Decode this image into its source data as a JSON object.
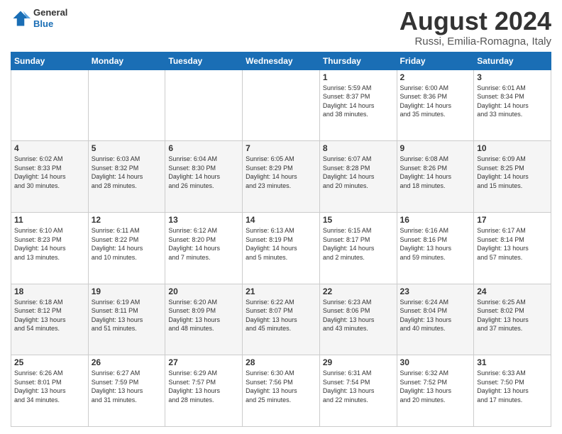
{
  "logo": {
    "line1": "General",
    "line2": "Blue"
  },
  "title": "August 2024",
  "subtitle": "Russi, Emilia-Romagna, Italy",
  "weekdays": [
    "Sunday",
    "Monday",
    "Tuesday",
    "Wednesday",
    "Thursday",
    "Friday",
    "Saturday"
  ],
  "weeks": [
    [
      {
        "day": "",
        "info": ""
      },
      {
        "day": "",
        "info": ""
      },
      {
        "day": "",
        "info": ""
      },
      {
        "day": "",
        "info": ""
      },
      {
        "day": "1",
        "info": "Sunrise: 5:59 AM\nSunset: 8:37 PM\nDaylight: 14 hours\nand 38 minutes."
      },
      {
        "day": "2",
        "info": "Sunrise: 6:00 AM\nSunset: 8:36 PM\nDaylight: 14 hours\nand 35 minutes."
      },
      {
        "day": "3",
        "info": "Sunrise: 6:01 AM\nSunset: 8:34 PM\nDaylight: 14 hours\nand 33 minutes."
      }
    ],
    [
      {
        "day": "4",
        "info": "Sunrise: 6:02 AM\nSunset: 8:33 PM\nDaylight: 14 hours\nand 30 minutes."
      },
      {
        "day": "5",
        "info": "Sunrise: 6:03 AM\nSunset: 8:32 PM\nDaylight: 14 hours\nand 28 minutes."
      },
      {
        "day": "6",
        "info": "Sunrise: 6:04 AM\nSunset: 8:30 PM\nDaylight: 14 hours\nand 26 minutes."
      },
      {
        "day": "7",
        "info": "Sunrise: 6:05 AM\nSunset: 8:29 PM\nDaylight: 14 hours\nand 23 minutes."
      },
      {
        "day": "8",
        "info": "Sunrise: 6:07 AM\nSunset: 8:28 PM\nDaylight: 14 hours\nand 20 minutes."
      },
      {
        "day": "9",
        "info": "Sunrise: 6:08 AM\nSunset: 8:26 PM\nDaylight: 14 hours\nand 18 minutes."
      },
      {
        "day": "10",
        "info": "Sunrise: 6:09 AM\nSunset: 8:25 PM\nDaylight: 14 hours\nand 15 minutes."
      }
    ],
    [
      {
        "day": "11",
        "info": "Sunrise: 6:10 AM\nSunset: 8:23 PM\nDaylight: 14 hours\nand 13 minutes."
      },
      {
        "day": "12",
        "info": "Sunrise: 6:11 AM\nSunset: 8:22 PM\nDaylight: 14 hours\nand 10 minutes."
      },
      {
        "day": "13",
        "info": "Sunrise: 6:12 AM\nSunset: 8:20 PM\nDaylight: 14 hours\nand 7 minutes."
      },
      {
        "day": "14",
        "info": "Sunrise: 6:13 AM\nSunset: 8:19 PM\nDaylight: 14 hours\nand 5 minutes."
      },
      {
        "day": "15",
        "info": "Sunrise: 6:15 AM\nSunset: 8:17 PM\nDaylight: 14 hours\nand 2 minutes."
      },
      {
        "day": "16",
        "info": "Sunrise: 6:16 AM\nSunset: 8:16 PM\nDaylight: 13 hours\nand 59 minutes."
      },
      {
        "day": "17",
        "info": "Sunrise: 6:17 AM\nSunset: 8:14 PM\nDaylight: 13 hours\nand 57 minutes."
      }
    ],
    [
      {
        "day": "18",
        "info": "Sunrise: 6:18 AM\nSunset: 8:12 PM\nDaylight: 13 hours\nand 54 minutes."
      },
      {
        "day": "19",
        "info": "Sunrise: 6:19 AM\nSunset: 8:11 PM\nDaylight: 13 hours\nand 51 minutes."
      },
      {
        "day": "20",
        "info": "Sunrise: 6:20 AM\nSunset: 8:09 PM\nDaylight: 13 hours\nand 48 minutes."
      },
      {
        "day": "21",
        "info": "Sunrise: 6:22 AM\nSunset: 8:07 PM\nDaylight: 13 hours\nand 45 minutes."
      },
      {
        "day": "22",
        "info": "Sunrise: 6:23 AM\nSunset: 8:06 PM\nDaylight: 13 hours\nand 43 minutes."
      },
      {
        "day": "23",
        "info": "Sunrise: 6:24 AM\nSunset: 8:04 PM\nDaylight: 13 hours\nand 40 minutes."
      },
      {
        "day": "24",
        "info": "Sunrise: 6:25 AM\nSunset: 8:02 PM\nDaylight: 13 hours\nand 37 minutes."
      }
    ],
    [
      {
        "day": "25",
        "info": "Sunrise: 6:26 AM\nSunset: 8:01 PM\nDaylight: 13 hours\nand 34 minutes."
      },
      {
        "day": "26",
        "info": "Sunrise: 6:27 AM\nSunset: 7:59 PM\nDaylight: 13 hours\nand 31 minutes."
      },
      {
        "day": "27",
        "info": "Sunrise: 6:29 AM\nSunset: 7:57 PM\nDaylight: 13 hours\nand 28 minutes."
      },
      {
        "day": "28",
        "info": "Sunrise: 6:30 AM\nSunset: 7:56 PM\nDaylight: 13 hours\nand 25 minutes."
      },
      {
        "day": "29",
        "info": "Sunrise: 6:31 AM\nSunset: 7:54 PM\nDaylight: 13 hours\nand 22 minutes."
      },
      {
        "day": "30",
        "info": "Sunrise: 6:32 AM\nSunset: 7:52 PM\nDaylight: 13 hours\nand 20 minutes."
      },
      {
        "day": "31",
        "info": "Sunrise: 6:33 AM\nSunset: 7:50 PM\nDaylight: 13 hours\nand 17 minutes."
      }
    ]
  ]
}
